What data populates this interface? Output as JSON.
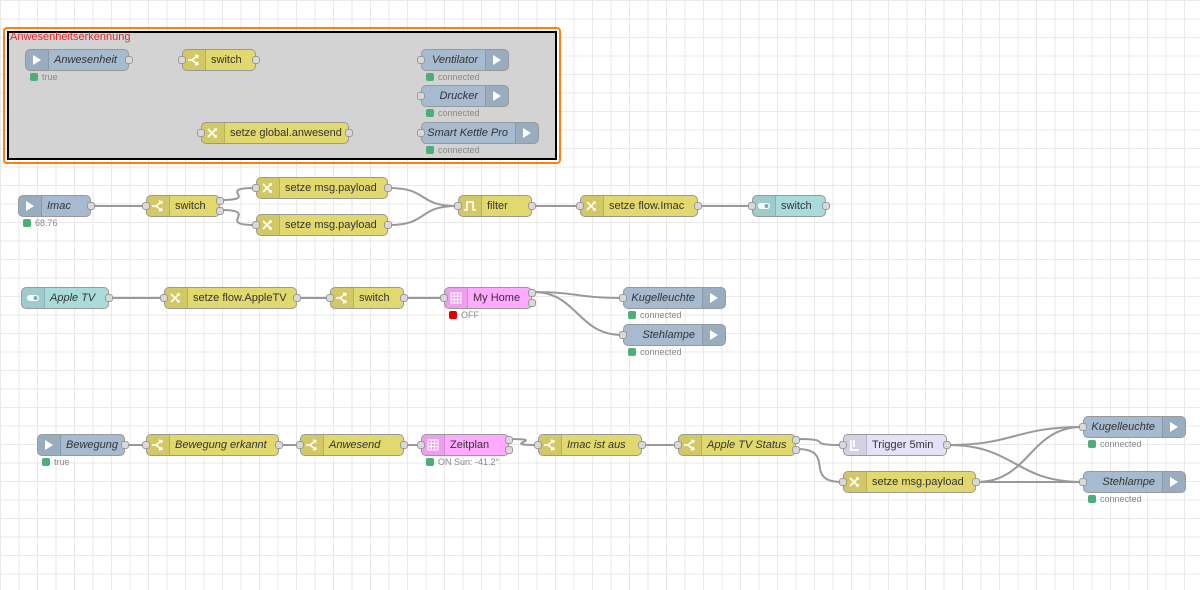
{
  "colors": {
    "grid": "#e9e9e9",
    "wire": "#999999",
    "wire_selected": "#ff7f0e",
    "group_fill": "#d3d3d3",
    "group_label": "#e8272c",
    "status_ok": "#4caf7a",
    "status_off": "#e00000",
    "node_blue": "#a6bbcf",
    "node_yellow": "#e2d96e",
    "node_teal": "#aadbdb",
    "node_pink": "#ffaaff",
    "node_lavender": "#e6e0f8"
  },
  "group": {
    "label": "Anwesenheitserkennung"
  },
  "nodes": [
    {
      "id": "anwesenheit",
      "label": "Anwesenheit",
      "italic": true,
      "color": "#a6bbcf",
      "icon": "arrow-in-icon",
      "icon_side": "left",
      "input": false,
      "outputs": 1,
      "status": {
        "dot": "#4caf7a",
        "text": "true"
      }
    },
    {
      "id": "sw1",
      "label": "switch",
      "italic": false,
      "color": "#e2d96e",
      "icon": "switch-icon",
      "icon_side": "left",
      "input": true,
      "outputs": 1
    },
    {
      "id": "setze_global",
      "label": "setze global.anwesend",
      "italic": false,
      "color": "#e2d96e",
      "icon": "change-icon",
      "icon_side": "left",
      "input": true,
      "outputs": 1
    },
    {
      "id": "ventilator",
      "label": "Ventilator",
      "italic": true,
      "color": "#a6bbcf",
      "icon": "arrow-out-icon",
      "icon_side": "right",
      "input": true,
      "outputs": 0,
      "status": {
        "dot": "#4caf7a",
        "text": "connected"
      }
    },
    {
      "id": "drucker",
      "label": "Drucker",
      "italic": true,
      "color": "#a6bbcf",
      "icon": "arrow-out-icon",
      "icon_side": "right",
      "input": true,
      "outputs": 0,
      "status": {
        "dot": "#4caf7a",
        "text": "connected"
      }
    },
    {
      "id": "kettle",
      "label": "Smart Kettle Pro",
      "italic": true,
      "color": "#a6bbcf",
      "icon": "arrow-out-icon",
      "icon_side": "right",
      "input": true,
      "outputs": 0,
      "status": {
        "dot": "#4caf7a",
        "text": "connected"
      }
    },
    {
      "id": "imac",
      "label": "Imac",
      "italic": true,
      "color": "#a6bbcf",
      "icon": "arrow-in-icon",
      "icon_side": "left",
      "input": false,
      "outputs": 1,
      "status": {
        "dot": "#4caf7a",
        "text": "68.76"
      }
    },
    {
      "id": "sw2",
      "label": "switch",
      "italic": false,
      "color": "#e2d96e",
      "icon": "switch-icon",
      "icon_side": "left",
      "input": true,
      "outputs": 2
    },
    {
      "id": "payload1",
      "label": "setze msg.payload",
      "italic": false,
      "color": "#e2d96e",
      "icon": "change-icon",
      "icon_side": "left",
      "input": true,
      "outputs": 1
    },
    {
      "id": "payload2",
      "label": "setze msg.payload",
      "italic": false,
      "color": "#e2d96e",
      "icon": "change-icon",
      "icon_side": "left",
      "input": true,
      "outputs": 1
    },
    {
      "id": "filter",
      "label": "filter",
      "italic": false,
      "color": "#e2d96e",
      "icon": "filter-icon",
      "icon_side": "left",
      "input": true,
      "outputs": 1
    },
    {
      "id": "setze_flow_imac",
      "label": "setze flow.Imac",
      "italic": false,
      "color": "#e2d96e",
      "icon": "change-icon",
      "icon_side": "left",
      "input": true,
      "outputs": 1
    },
    {
      "id": "switch_out",
      "label": "switch",
      "italic": false,
      "color": "#aadbdb",
      "icon": "toggle-icon",
      "icon_side": "left",
      "input": true,
      "outputs": 1
    },
    {
      "id": "appletv",
      "label": "Apple TV",
      "italic": true,
      "color": "#aadbdb",
      "icon": "toggle-icon",
      "icon_side": "left",
      "input": false,
      "outputs": 1
    },
    {
      "id": "setze_flow_atv",
      "label": "setze flow.AppleTV",
      "italic": false,
      "color": "#e2d96e",
      "icon": "change-icon",
      "icon_side": "left",
      "input": true,
      "outputs": 1
    },
    {
      "id": "sw3",
      "label": "switch",
      "italic": false,
      "color": "#e2d96e",
      "icon": "switch-icon",
      "icon_side": "left",
      "input": true,
      "outputs": 1
    },
    {
      "id": "myhome",
      "label": "My Home",
      "italic": false,
      "color": "#ffaaff",
      "icon": "grid-icon",
      "icon_side": "left",
      "input": true,
      "outputs": 2,
      "status": {
        "dot": "#e00000",
        "text": "OFF"
      }
    },
    {
      "id": "kugel1",
      "label": "Kugelleuchte",
      "italic": true,
      "color": "#a6bbcf",
      "icon": "arrow-out-icon",
      "icon_side": "right",
      "input": true,
      "outputs": 0,
      "status": {
        "dot": "#4caf7a",
        "text": "connected"
      }
    },
    {
      "id": "steh1",
      "label": "Stehlampe",
      "italic": true,
      "color": "#a6bbcf",
      "icon": "arrow-out-icon",
      "icon_side": "right",
      "input": true,
      "outputs": 0,
      "status": {
        "dot": "#4caf7a",
        "text": "connected"
      }
    },
    {
      "id": "bewegung",
      "label": "Bewegung",
      "italic": true,
      "color": "#a6bbcf",
      "icon": "arrow-in-icon",
      "icon_side": "left",
      "input": false,
      "outputs": 1,
      "status": {
        "dot": "#4caf7a",
        "text": "true"
      }
    },
    {
      "id": "bew_erkannt",
      "label": "Bewegung erkannt",
      "italic": true,
      "color": "#e2d96e",
      "icon": "switch-icon",
      "icon_side": "left",
      "input": true,
      "outputs": 1
    },
    {
      "id": "anwesend",
      "label": "Anwesend",
      "italic": true,
      "color": "#e2d96e",
      "icon": "switch-icon",
      "icon_side": "left",
      "input": true,
      "outputs": 1
    },
    {
      "id": "zeitplan",
      "label": "Zeitplan",
      "italic": false,
      "color": "#ffaaff",
      "icon": "grid-icon",
      "icon_side": "left",
      "input": true,
      "outputs": 2,
      "status": {
        "dot": "#4caf7a",
        "text": "ON Sun: -41.2°"
      }
    },
    {
      "id": "imac_aus",
      "label": "Imac ist aus",
      "italic": true,
      "color": "#e2d96e",
      "icon": "switch-icon",
      "icon_side": "left",
      "input": true,
      "outputs": 1
    },
    {
      "id": "atv_status",
      "label": "Apple TV Status",
      "italic": true,
      "color": "#e2d96e",
      "icon": "switch-icon",
      "icon_side": "left",
      "input": true,
      "outputs": 2
    },
    {
      "id": "trigger",
      "label": "Trigger 5min",
      "italic": false,
      "color": "#e6e0f8",
      "icon": "trigger-icon",
      "icon_side": "left",
      "input": true,
      "outputs": 1
    },
    {
      "id": "payload3",
      "label": "setze msg.payload",
      "italic": false,
      "color": "#e2d96e",
      "icon": "change-icon",
      "icon_side": "left",
      "input": true,
      "outputs": 1
    },
    {
      "id": "kugel2",
      "label": "Kugelleuchte",
      "italic": true,
      "color": "#a6bbcf",
      "icon": "arrow-out-icon",
      "icon_side": "right",
      "input": true,
      "outputs": 0,
      "status": {
        "dot": "#4caf7a",
        "text": "connected"
      }
    },
    {
      "id": "steh2",
      "label": "Stehlampe",
      "italic": true,
      "color": "#a6bbcf",
      "icon": "arrow-out-icon",
      "icon_side": "right",
      "input": true,
      "outputs": 0,
      "status": {
        "dot": "#4caf7a",
        "text": "connected"
      }
    }
  ],
  "wires": [
    {
      "from": "anwesenheit",
      "port": 0,
      "to": "sw1",
      "selected": true
    },
    {
      "from": "anwesenheit",
      "port": 0,
      "to": "setze_global",
      "selected": true
    },
    {
      "from": "sw1",
      "port": 0,
      "to": "ventilator",
      "selected": true
    },
    {
      "from": "sw1",
      "port": 0,
      "to": "drucker",
      "selected": true
    },
    {
      "from": "sw1",
      "port": 0,
      "to": "kettle",
      "selected": true
    },
    {
      "from": "imac",
      "port": 0,
      "to": "sw2"
    },
    {
      "from": "sw2",
      "port": 0,
      "to": "payload1"
    },
    {
      "from": "sw2",
      "port": 1,
      "to": "payload2"
    },
    {
      "from": "payload1",
      "port": 0,
      "to": "filter"
    },
    {
      "from": "payload2",
      "port": 0,
      "to": "filter"
    },
    {
      "from": "filter",
      "port": 0,
      "to": "setze_flow_imac"
    },
    {
      "from": "setze_flow_imac",
      "port": 0,
      "to": "switch_out"
    },
    {
      "from": "appletv",
      "port": 0,
      "to": "setze_flow_atv"
    },
    {
      "from": "setze_flow_atv",
      "port": 0,
      "to": "sw3"
    },
    {
      "from": "sw3",
      "port": 0,
      "to": "myhome"
    },
    {
      "from": "myhome",
      "port": 0,
      "to": "kugel1"
    },
    {
      "from": "myhome",
      "port": 0,
      "to": "steh1"
    },
    {
      "from": "bewegung",
      "port": 0,
      "to": "bew_erkannt"
    },
    {
      "from": "bew_erkannt",
      "port": 0,
      "to": "anwesend"
    },
    {
      "from": "anwesend",
      "port": 0,
      "to": "zeitplan"
    },
    {
      "from": "zeitplan",
      "port": 0,
      "to": "imac_aus"
    },
    {
      "from": "imac_aus",
      "port": 0,
      "to": "atv_status"
    },
    {
      "from": "atv_status",
      "port": 0,
      "to": "trigger"
    },
    {
      "from": "atv_status",
      "port": 1,
      "to": "payload3"
    },
    {
      "from": "trigger",
      "port": 0,
      "to": "kugel2"
    },
    {
      "from": "trigger",
      "port": 0,
      "to": "steh2"
    },
    {
      "from": "payload3",
      "port": 0,
      "to": "kugel2"
    },
    {
      "from": "payload3",
      "port": 0,
      "to": "steh2"
    }
  ]
}
